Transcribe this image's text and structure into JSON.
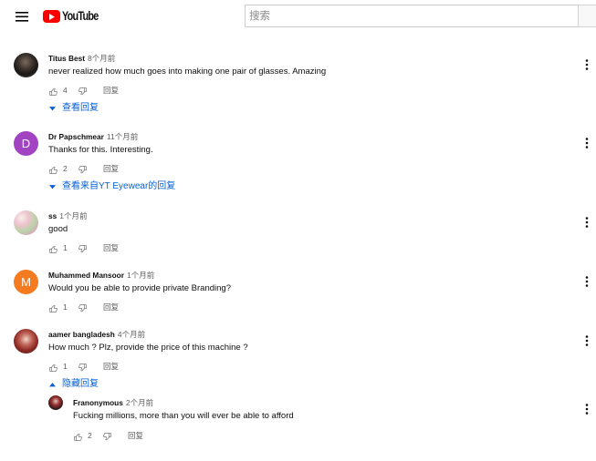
{
  "theme": {
    "link": "#065fd4",
    "brand": "#ff0000",
    "text": "#0f0f0f",
    "muted": "#606060"
  },
  "icons": {
    "menu": "hamburger-menu-icon",
    "like": "thumb-up-icon",
    "dislike": "thumb-down-icon",
    "more": "more-vert-icon",
    "expand": "caret-down-icon",
    "collapse": "caret-up-icon"
  },
  "header": {
    "logo_text": "YouTube",
    "search_placeholder": "搜索"
  },
  "comments": [
    {
      "author": "Titus Best",
      "time": "8个月前",
      "text": "never realized how much goes into making one pair of glasses. Amazing",
      "likes": "4",
      "reply_label": "回复",
      "replies_toggle": "查看回复"
    },
    {
      "author": "Dr Papschmear",
      "time": "11个月前",
      "avatar_letter": "D",
      "avatar_color": "#a244c2",
      "text": "Thanks for this. Interesting.",
      "likes": "2",
      "reply_label": "回复",
      "replies_toggle": "查看来自YT Eyewear的回复"
    },
    {
      "author": "ss",
      "time": "1个月前",
      "text": "good",
      "likes": "1",
      "reply_label": "回复"
    },
    {
      "author": "Muhammed Mansoor",
      "time": "1个月前",
      "avatar_letter": "M",
      "avatar_color": "#f47b20",
      "text": "Would you be able to provide private Branding?",
      "likes": "1",
      "reply_label": "回复"
    },
    {
      "author": "aamer bangladesh",
      "time": "4个月前",
      "text": "How much ? Plz, provide the price of this machine ?",
      "likes": "1",
      "reply_label": "回复",
      "replies_toggle": "隐藏回复",
      "replies": [
        {
          "author": "Franonymous",
          "time": "2个月前",
          "text": "Fucking millions, more than you will ever be able to afford",
          "likes": "2",
          "reply_label": "回复"
        }
      ]
    }
  ]
}
